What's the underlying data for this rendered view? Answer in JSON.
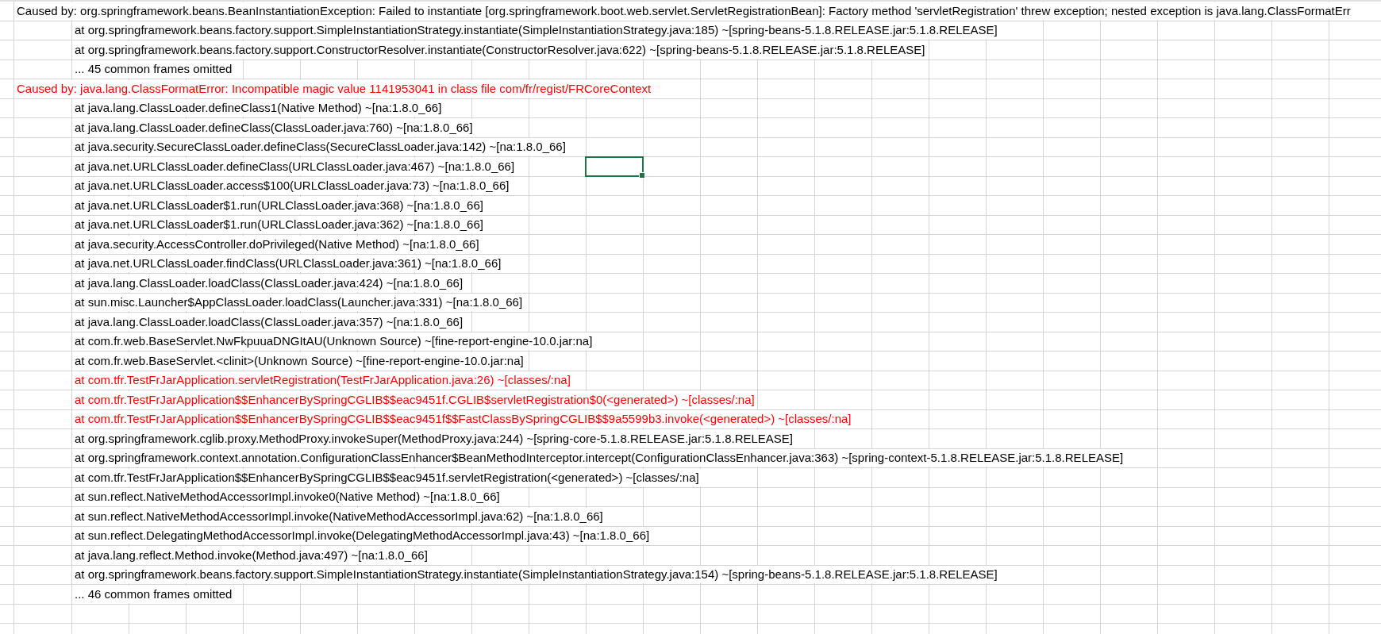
{
  "rows": [
    {
      "kind": "cause",
      "highlighted": false,
      "selected": false,
      "text": "Caused by: org.springframework.beans.BeanInstantiationException: Failed to instantiate [org.springframework.boot.web.servlet.ServletRegistrationBean]: Factory method 'servletRegistration' threw exception; nested exception is java.lang.ClassFormatErr"
    },
    {
      "kind": "frame",
      "highlighted": false,
      "selected": false,
      "text": "at org.springframework.beans.factory.support.SimpleInstantiationStrategy.instantiate(SimpleInstantiationStrategy.java:185) ~[spring-beans-5.1.8.RELEASE.jar:5.1.8.RELEASE]"
    },
    {
      "kind": "frame",
      "highlighted": false,
      "selected": false,
      "text": "at org.springframework.beans.factory.support.ConstructorResolver.instantiate(ConstructorResolver.java:622) ~[spring-beans-5.1.8.RELEASE.jar:5.1.8.RELEASE]"
    },
    {
      "kind": "frame",
      "highlighted": false,
      "selected": false,
      "text": "... 45 common frames omitted"
    },
    {
      "kind": "cause",
      "highlighted": true,
      "selected": false,
      "text": "Caused by: java.lang.ClassFormatError: Incompatible magic value 1141953041 in class file com/fr/regist/FRCoreContext"
    },
    {
      "kind": "frame",
      "highlighted": false,
      "selected": false,
      "text": "at java.lang.ClassLoader.defineClass1(Native Method) ~[na:1.8.0_66]"
    },
    {
      "kind": "frame",
      "highlighted": false,
      "selected": false,
      "text": "at java.lang.ClassLoader.defineClass(ClassLoader.java:760) ~[na:1.8.0_66]"
    },
    {
      "kind": "frame",
      "highlighted": false,
      "selected": false,
      "text": "at java.security.SecureClassLoader.defineClass(SecureClassLoader.java:142) ~[na:1.8.0_66]"
    },
    {
      "kind": "frame",
      "highlighted": false,
      "selected": true,
      "text": "at java.net.URLClassLoader.defineClass(URLClassLoader.java:467) ~[na:1.8.0_66]"
    },
    {
      "kind": "frame",
      "highlighted": false,
      "selected": false,
      "text": "at java.net.URLClassLoader.access$100(URLClassLoader.java:73) ~[na:1.8.0_66]"
    },
    {
      "kind": "frame",
      "highlighted": false,
      "selected": false,
      "text": "at java.net.URLClassLoader$1.run(URLClassLoader.java:368) ~[na:1.8.0_66]"
    },
    {
      "kind": "frame",
      "highlighted": false,
      "selected": false,
      "text": "at java.net.URLClassLoader$1.run(URLClassLoader.java:362) ~[na:1.8.0_66]"
    },
    {
      "kind": "frame",
      "highlighted": false,
      "selected": false,
      "text": "at java.security.AccessController.doPrivileged(Native Method) ~[na:1.8.0_66]"
    },
    {
      "kind": "frame",
      "highlighted": false,
      "selected": false,
      "text": "at java.net.URLClassLoader.findClass(URLClassLoader.java:361) ~[na:1.8.0_66]"
    },
    {
      "kind": "frame",
      "highlighted": false,
      "selected": false,
      "text": "at java.lang.ClassLoader.loadClass(ClassLoader.java:424) ~[na:1.8.0_66]"
    },
    {
      "kind": "frame",
      "highlighted": false,
      "selected": false,
      "text": "at sun.misc.Launcher$AppClassLoader.loadClass(Launcher.java:331) ~[na:1.8.0_66]"
    },
    {
      "kind": "frame",
      "highlighted": false,
      "selected": false,
      "text": "at java.lang.ClassLoader.loadClass(ClassLoader.java:357) ~[na:1.8.0_66]"
    },
    {
      "kind": "frame",
      "highlighted": false,
      "selected": false,
      "text": "at com.fr.web.BaseServlet.NwFkpuuaDNGItAU(Unknown Source) ~[fine-report-engine-10.0.jar:na]"
    },
    {
      "kind": "frame",
      "highlighted": false,
      "selected": false,
      "text": "at com.fr.web.BaseServlet.<clinit>(Unknown Source) ~[fine-report-engine-10.0.jar:na]"
    },
    {
      "kind": "frame",
      "highlighted": true,
      "selected": false,
      "text": "at com.tfr.TestFrJarApplication.servletRegistration(TestFrJarApplication.java:26) ~[classes/:na]"
    },
    {
      "kind": "frame",
      "highlighted": true,
      "selected": false,
      "text": "at com.tfr.TestFrJarApplication$$EnhancerBySpringCGLIB$$eac9451f.CGLIB$servletRegistration$0(<generated>) ~[classes/:na]"
    },
    {
      "kind": "frame",
      "highlighted": true,
      "selected": false,
      "text": "at com.tfr.TestFrJarApplication$$EnhancerBySpringCGLIB$$eac9451f$$FastClassBySpringCGLIB$$9a5599b3.invoke(<generated>) ~[classes/:na]"
    },
    {
      "kind": "frame",
      "highlighted": false,
      "selected": false,
      "text": "at org.springframework.cglib.proxy.MethodProxy.invokeSuper(MethodProxy.java:244) ~[spring-core-5.1.8.RELEASE.jar:5.1.8.RELEASE]"
    },
    {
      "kind": "frame",
      "highlighted": false,
      "selected": false,
      "text": "at org.springframework.context.annotation.ConfigurationClassEnhancer$BeanMethodInterceptor.intercept(ConfigurationClassEnhancer.java:363) ~[spring-context-5.1.8.RELEASE.jar:5.1.8.RELEASE]"
    },
    {
      "kind": "frame",
      "highlighted": false,
      "selected": false,
      "text": "at com.tfr.TestFrJarApplication$$EnhancerBySpringCGLIB$$eac9451f.servletRegistration(<generated>) ~[classes/:na]"
    },
    {
      "kind": "frame",
      "highlighted": false,
      "selected": false,
      "text": "at sun.reflect.NativeMethodAccessorImpl.invoke0(Native Method) ~[na:1.8.0_66]"
    },
    {
      "kind": "frame",
      "highlighted": false,
      "selected": false,
      "text": "at sun.reflect.NativeMethodAccessorImpl.invoke(NativeMethodAccessorImpl.java:62) ~[na:1.8.0_66]"
    },
    {
      "kind": "frame",
      "highlighted": false,
      "selected": false,
      "text": "at sun.reflect.DelegatingMethodAccessorImpl.invoke(DelegatingMethodAccessorImpl.java:43) ~[na:1.8.0_66]"
    },
    {
      "kind": "frame",
      "highlighted": false,
      "selected": false,
      "text": "at java.lang.reflect.Method.invoke(Method.java:497) ~[na:1.8.0_66]"
    },
    {
      "kind": "frame",
      "highlighted": false,
      "selected": false,
      "text": "at org.springframework.beans.factory.support.SimpleInstantiationStrategy.instantiate(SimpleInstantiationStrategy.java:154) ~[spring-beans-5.1.8.RELEASE.jar:5.1.8.RELEASE]"
    },
    {
      "kind": "frame",
      "highlighted": false,
      "selected": false,
      "text": "... 46 common frames omitted"
    }
  ]
}
